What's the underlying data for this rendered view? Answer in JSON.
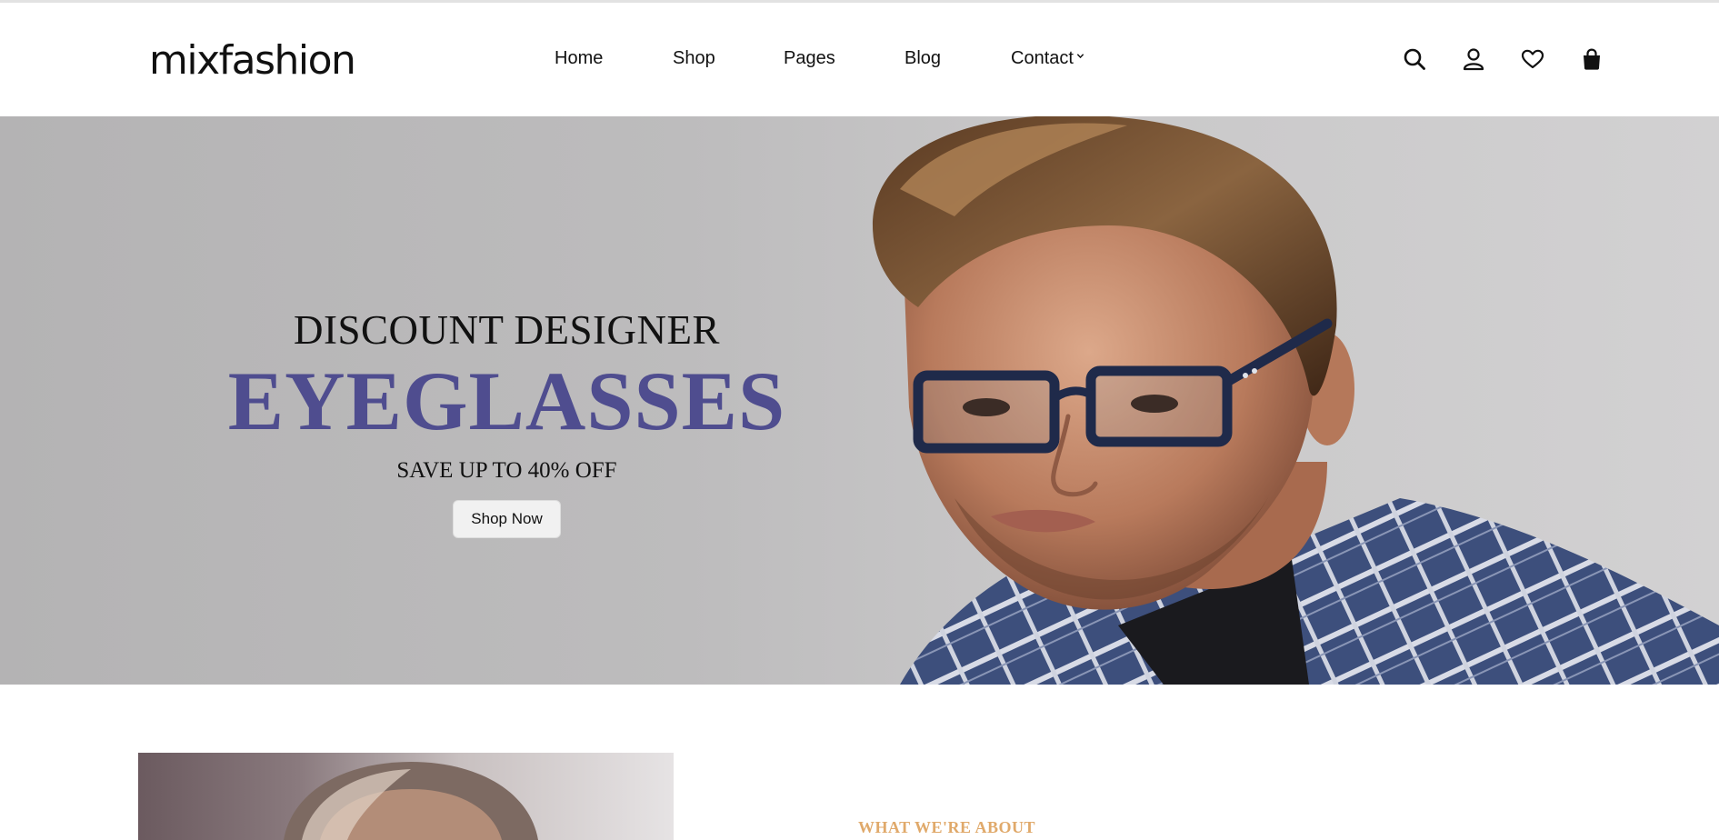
{
  "brand": {
    "logo_text": "mixfashion"
  },
  "nav": {
    "items": [
      {
        "label": "Home"
      },
      {
        "label": "Shop"
      },
      {
        "label": "Pages"
      },
      {
        "label": "Blog"
      },
      {
        "label": "Contact"
      }
    ]
  },
  "header_icons": [
    "search-icon",
    "user-icon",
    "heart-icon",
    "shopping-bag-icon"
  ],
  "hero": {
    "kicker": "DISCOUNT DESIGNER",
    "headline": "EYEGLASSES",
    "subline": "SAVE UP TO 40% OFF",
    "cta_label": "Shop Now"
  },
  "about": {
    "kicker": "WHAT WE'RE ABOUT"
  },
  "colors": {
    "accent_headline": "#4f4d8f",
    "accent_kicker": "#e0a96a",
    "hero_bg": "#bdbcbd"
  }
}
